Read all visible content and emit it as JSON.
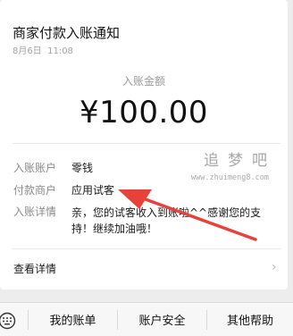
{
  "notice": {
    "title": "商家付款入账通知",
    "date": "8月6日",
    "time": "11:08",
    "amount_label": "入账金额",
    "amount": "¥100.00"
  },
  "rows": [
    {
      "label": "入账账户",
      "value": "零钱"
    },
    {
      "label": "付款商户",
      "value": "应用试客"
    },
    {
      "label": "入账详情",
      "value": "亲，您的试客收入到账啦^^感谢您的支持！继续加油哦！"
    }
  ],
  "watermark": {
    "name": "追梦吧",
    "url": "www.zhuimeng8.com"
  },
  "details_link": "查看详情",
  "bottom_menu": [
    "我的账单",
    "账户安全",
    "其他帮助"
  ],
  "colors": {
    "arrow": "#e8413a",
    "card": "#ffffff",
    "background": "#ededed"
  }
}
